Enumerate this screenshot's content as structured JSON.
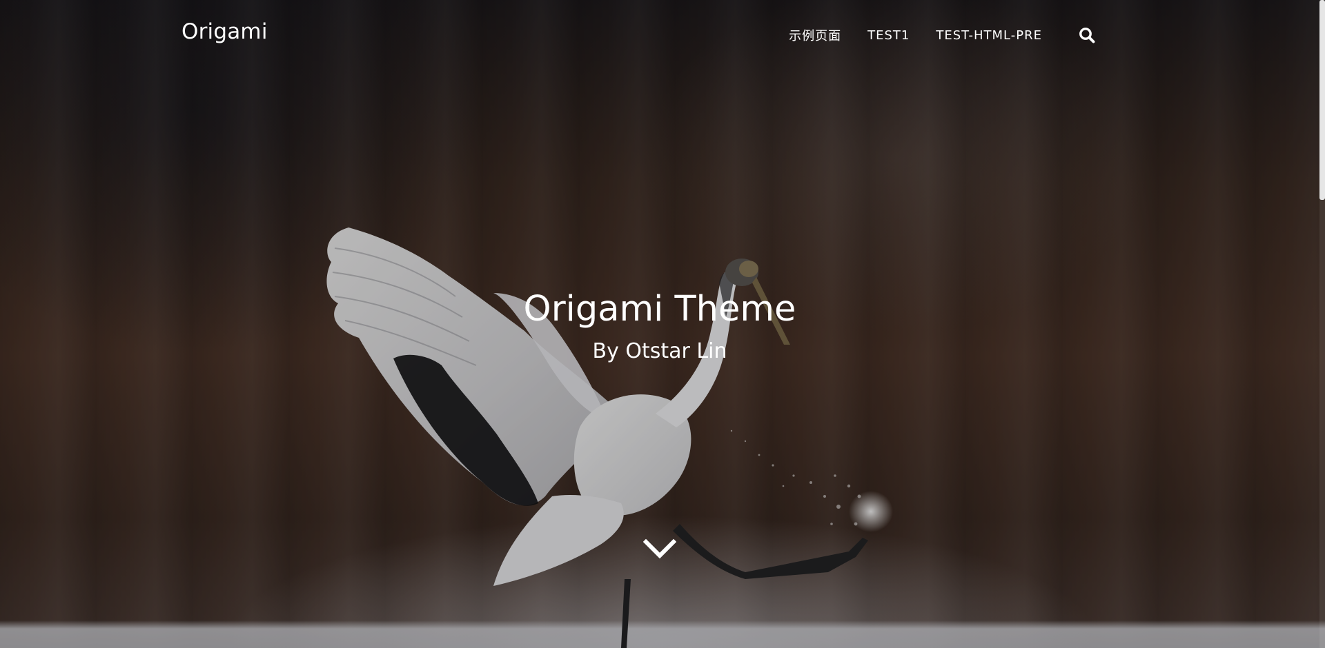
{
  "site": {
    "brand": "Origami"
  },
  "nav": {
    "items": [
      {
        "label": "示例页面"
      },
      {
        "label": "TEST1"
      },
      {
        "label": "TEST-HTML-PRE"
      }
    ],
    "search_icon": "search-icon"
  },
  "hero": {
    "title": "Origami Theme",
    "subtitle": "By Otstar Lin",
    "scroll_icon": "chevron-down-icon"
  },
  "colors": {
    "text": "#ffffff",
    "scrollbar_thumb": "#e6e6e6"
  }
}
